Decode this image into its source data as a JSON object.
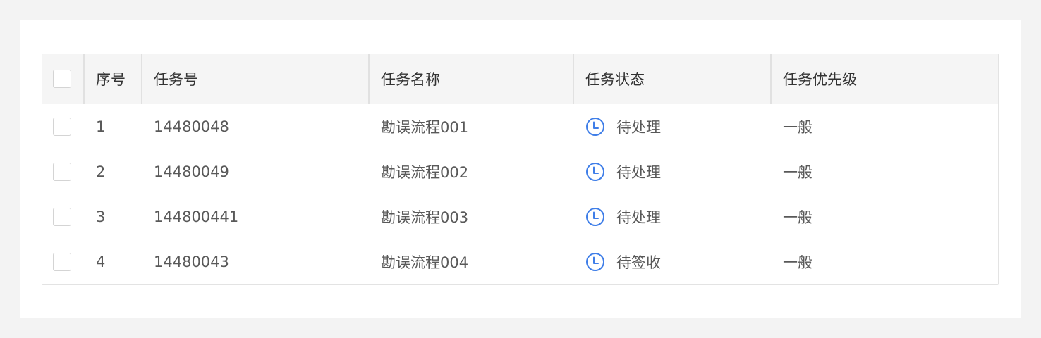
{
  "table": {
    "headers": {
      "index": "序号",
      "task_no": "任务号",
      "task_name": "任务名称",
      "task_status": "任务状态",
      "task_priority": "任务优先级"
    },
    "rows": [
      {
        "index": "1",
        "task_no": "14480048",
        "task_name": "勘误流程001",
        "status_icon": "clock-icon",
        "task_status": "待处理",
        "task_priority": "一般"
      },
      {
        "index": "2",
        "task_no": "14480049",
        "task_name": "勘误流程002",
        "status_icon": "clock-icon",
        "task_status": "待处理",
        "task_priority": "一般"
      },
      {
        "index": "3",
        "task_no": "144800441",
        "task_name": "勘误流程003",
        "status_icon": "clock-icon",
        "task_status": "待处理",
        "task_priority": "一般"
      },
      {
        "index": "4",
        "task_no": "14480043",
        "task_name": "勘误流程004",
        "status_icon": "clock-icon",
        "task_status": "待签收",
        "task_priority": "一般"
      }
    ]
  },
  "colors": {
    "status_icon": "#3f7ee8",
    "header_background": "#f5f5f5",
    "page_background": "#f3f3f3"
  }
}
